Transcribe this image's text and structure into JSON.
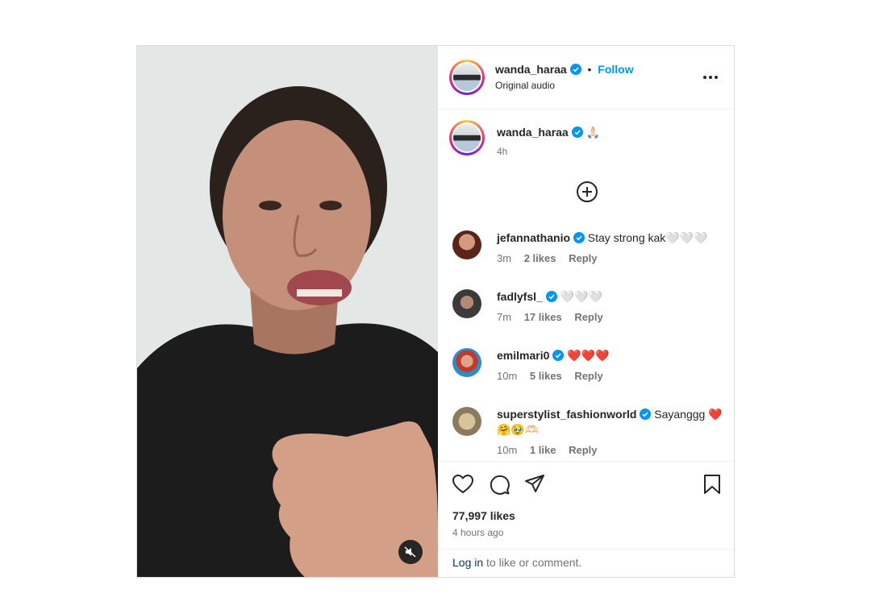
{
  "header": {
    "username": "wanda_haraa",
    "dot": "•",
    "follow_label": "Follow",
    "audio_label": "Original audio",
    "more_icon": "more-horizontal-icon"
  },
  "caption": {
    "username": "wanda_haraa",
    "emoji": "🙏🏻",
    "time": "4h"
  },
  "load_more_icon": "plus-circle-icon",
  "comments": [
    {
      "username": "jefannathanio",
      "text": "Stay strong kak🤍🤍🤍",
      "time": "3m",
      "likes": "2 likes",
      "reply": "Reply",
      "avatar_color": "#7a3b2a"
    },
    {
      "username": "fadlyfsl_",
      "text": "🤍🤍🤍",
      "time": "7m",
      "likes": "17 likes",
      "reply": "Reply",
      "avatar_color": "#4a4a4a"
    },
    {
      "username": "emilmari0",
      "text": "❤️❤️❤️",
      "time": "10m",
      "likes": "5 likes",
      "reply": "Reply",
      "avatar_color": "#2e8bc8"
    },
    {
      "username": "superstylist_fashionworld",
      "text": "Sayanggg ❤️🤗🥹🫶🏻",
      "time": "10m",
      "likes": "1 like",
      "reply": "Reply",
      "avatar_color": "#b9a68a"
    }
  ],
  "actions": {
    "like_icon": "heart-icon",
    "comment_icon": "comment-icon",
    "share_icon": "send-icon",
    "save_icon": "bookmark-icon"
  },
  "likes_count": "77,997 likes",
  "posted_ago": "4 hours ago",
  "footer": {
    "login_link": "Log in",
    "login_rest": " to like or comment."
  },
  "video": {
    "mute_icon": "muted-speaker-icon"
  },
  "colors": {
    "accent": "#0095f6",
    "verified": "#0095f6",
    "text": "#262626",
    "muted": "#737373",
    "heart_red": "#e0245e"
  }
}
